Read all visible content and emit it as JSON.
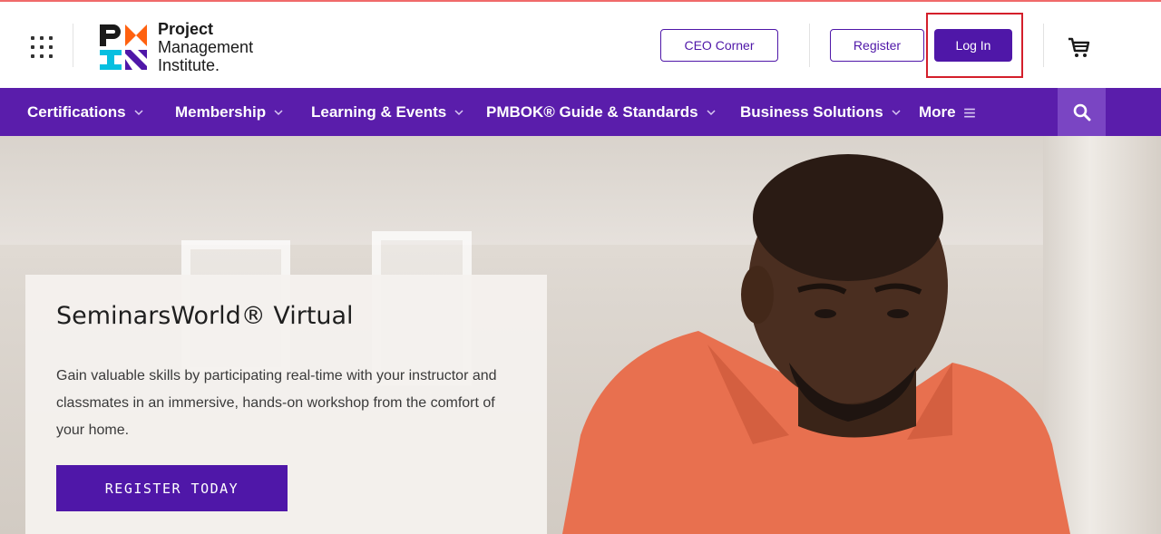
{
  "header": {
    "logo": {
      "line1": "Project",
      "line2": "Management",
      "line3": "Institute."
    },
    "ceo_corner_label": "CEO Corner",
    "register_label": "Register",
    "login_label": "Log In"
  },
  "nav": {
    "items": [
      {
        "label": "Certifications"
      },
      {
        "label": "Membership"
      },
      {
        "label": "Learning & Events"
      },
      {
        "label": "PMBOK® Guide & Standards"
      },
      {
        "label": "Business Solutions"
      },
      {
        "label": "More"
      }
    ]
  },
  "hero": {
    "title": "SeminarsWorld® Virtual",
    "description": "Gain valuable skills by participating real-time with your instructor and classmates in an immersive, hands-on workshop from the comfort of your home.",
    "cta_label": "REGISTER TODAY"
  },
  "colors": {
    "brand_purple": "#4f17a8",
    "nav_purple": "#5a1dab",
    "highlight_red": "#d41f2b"
  },
  "icons": [
    "app-grid-icon",
    "pmi-logo-icon",
    "cart-icon",
    "chevron-down-icon",
    "menu-icon",
    "search-icon"
  ]
}
